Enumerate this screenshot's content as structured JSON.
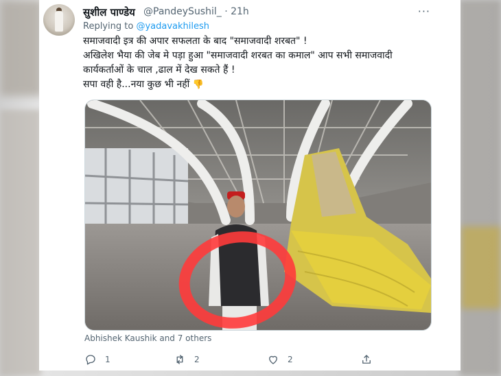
{
  "tweet": {
    "author_name": "सुशील पाण्डेय",
    "author_handle": "@PandeySushil_",
    "time": "· 21h",
    "more": "···",
    "replying_prefix": "Replying to ",
    "replying_handle": "@yadavakhilesh",
    "lines": [
      "समाजवादी इत्र की अपार सफलता के बाद \"समाजवादी शरबत\" !",
      "अखिलेश भैया की जेब मे पड़ा हुआ \"समाजवादी शरबत का कमाल\" आप सभी समाजवादी",
      "कार्यकर्ताओं के चाल ,ढाल में देख सकते हैं !",
      "सपा वही है...नया कुछ भी नहीं"
    ],
    "emoji": "👎",
    "liked_by": "Abhishek Kaushik and 7 others"
  },
  "actions": {
    "reply_count": "1",
    "retweet_count": "2",
    "like_count": "2"
  },
  "icons": [
    "avatar",
    "more-icon",
    "reply-icon",
    "retweet-icon",
    "like-icon",
    "share-icon"
  ],
  "colors": {
    "link": "#1d9bf0",
    "muted": "#536471",
    "text": "#0f1419",
    "circle": "#ff3b3b"
  }
}
